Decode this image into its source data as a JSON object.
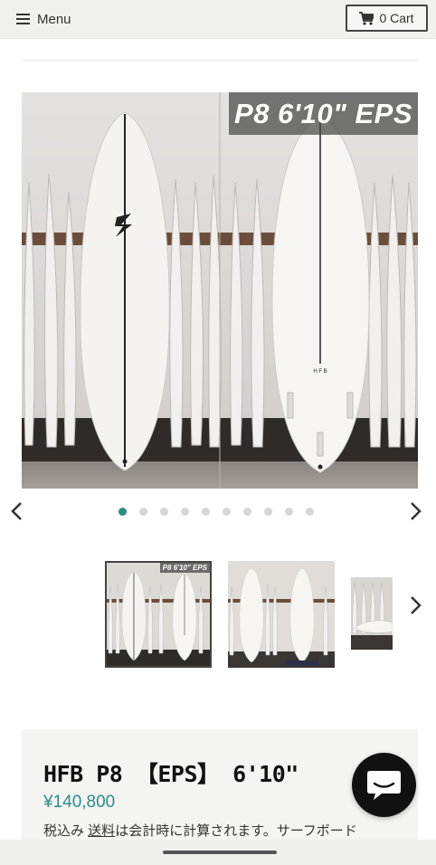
{
  "header": {
    "menu_label": "Menu",
    "cart_label": "0 Cart",
    "menu_icon": "hamburger-icon",
    "cart_icon": "cart-icon"
  },
  "gallery": {
    "caption": "P8 6'10\" EPS",
    "prev_icon": "chevron-left-icon",
    "next_icon": "chevron-right-icon",
    "dot_count": 10,
    "active_dot": 1,
    "thumbnails": [
      {
        "caption": "P8 6'10\" EPS"
      },
      {
        "caption": ""
      },
      {
        "caption": ""
      }
    ]
  },
  "product": {
    "title": "HFB P8 【EPS】 6'10\"",
    "price": "¥140,800",
    "tax_prefix": "税込み ",
    "tax_link": "送料",
    "tax_suffix": "は会計時に計算されます。サーフボード"
  },
  "colors": {
    "accent": "#2c8c8a",
    "topbar": "#f0f0ef",
    "chat_button": "#111111"
  }
}
